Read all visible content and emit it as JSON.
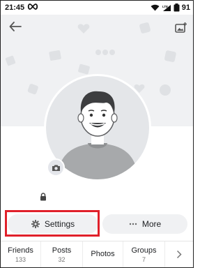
{
  "status_bar": {
    "time": "21:45",
    "battery": "91",
    "icons": [
      "infinity-icon",
      "wifi-icon",
      "lte-signal-icon",
      "battery-icon"
    ]
  },
  "header": {
    "back_icon": "arrow-left-icon",
    "cover_icon": "add-photo-icon"
  },
  "profile": {
    "avatar_icon": "cartoon-person-avatar",
    "camera_icon": "camera-icon",
    "privacy_icon": "lock-icon"
  },
  "actions": {
    "settings": {
      "label": "Settings",
      "icon": "gear-icon"
    },
    "more": {
      "label": "More",
      "icon": "dots-icon"
    }
  },
  "tabs": [
    {
      "label": "Friends",
      "count": "133"
    },
    {
      "label": "Posts",
      "count": "32"
    },
    {
      "label": "Photos",
      "count": ""
    },
    {
      "label": "Groups",
      "count": "7"
    }
  ],
  "colors": {
    "highlight": "#e0202a",
    "cover_bg": "#f0f1f3",
    "button_bg": "#f0f1f3"
  }
}
